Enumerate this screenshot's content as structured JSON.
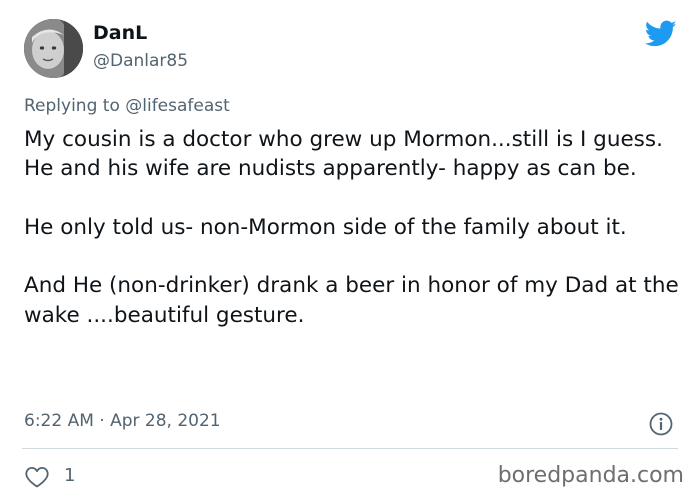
{
  "author": {
    "display_name": "DanL",
    "handle": "@Danlar85",
    "avatar": "avatar-photo"
  },
  "platform": {
    "logo": "twitter-bird-icon",
    "accent_color": "#1d9bf0"
  },
  "reply": {
    "text": "Replying to @lifesafeast"
  },
  "tweet": {
    "paragraphs": [
      "My cousin is a doctor who grew up Mormon...still is I guess. He and his wife are nudists apparently- happy as can be.",
      "He only told us- non-Mormon side of the family about it.",
      "And He (non-drinker) drank a beer in honor of my Dad at the wake ....beautiful gesture."
    ],
    "timestamp": "6:22 AM · Apr 28, 2021"
  },
  "actions": {
    "like_icon": "heart-icon",
    "like_count": "1",
    "info_icon": "info-icon"
  },
  "watermark": "boredpanda.com"
}
